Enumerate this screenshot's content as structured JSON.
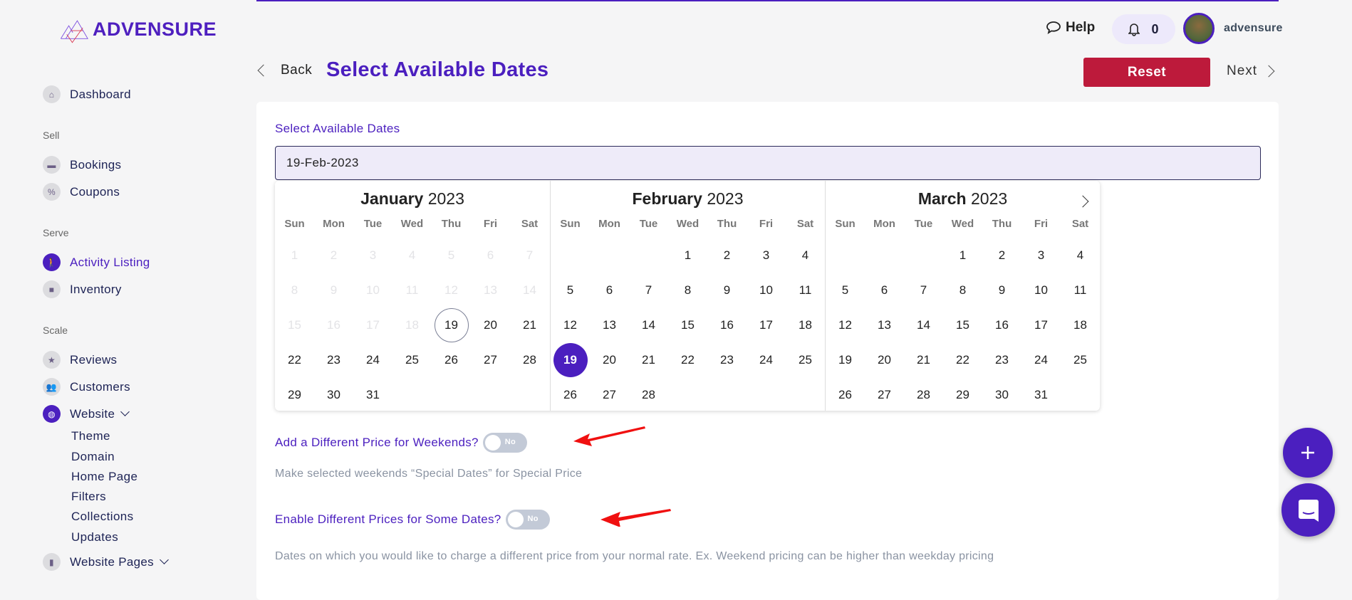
{
  "brand": {
    "name": "ADVENSURE",
    "colors": {
      "primary": "#4b1fbf",
      "danger": "#bd1a3b"
    }
  },
  "sidebar": {
    "items": [
      {
        "label": "Dashboard",
        "icon": "home-icon"
      },
      {
        "section": "Sell"
      },
      {
        "label": "Bookings",
        "icon": "card-icon"
      },
      {
        "label": "Coupons",
        "icon": "percent-icon"
      },
      {
        "section": "Serve"
      },
      {
        "label": "Activity Listing",
        "icon": "hiker-icon",
        "active": true
      },
      {
        "label": "Inventory",
        "icon": "box-icon"
      },
      {
        "section": "Scale"
      },
      {
        "label": "Reviews",
        "icon": "star-icon"
      },
      {
        "label": "Customers",
        "icon": "people-icon"
      },
      {
        "label": "Website",
        "icon": "globe-icon",
        "expanded": true
      },
      {
        "label": "Website Pages",
        "icon": "page-icon"
      }
    ],
    "website_subitems": [
      "Theme",
      "Domain",
      "Home Page",
      "Filters",
      "Collections",
      "Updates"
    ]
  },
  "header": {
    "help": "Help",
    "notifications": "0",
    "username": "advensure"
  },
  "page": {
    "back": "Back",
    "title": "Select Available Dates",
    "reset": "Reset",
    "next": "Next"
  },
  "form": {
    "dates_label": "Select Available Dates",
    "dates_value": "19-Feb-2023",
    "weekend_label": "Add a Different Price for Weekends?",
    "weekend_toggle": "No",
    "weekend_desc": "Make selected weekends “Special Dates” for Special Price",
    "special_label": "Enable Different Prices for Some Dates?",
    "special_toggle": "No",
    "special_desc": "Dates on which you would like to charge a different price from your normal rate. Ex. Weekend pricing can be higher than weekday pricing"
  },
  "calendar": {
    "weekdays": [
      "Sun",
      "Mon",
      "Tue",
      "Wed",
      "Thu",
      "Fri",
      "Sat"
    ],
    "months": [
      {
        "name": "January",
        "year": "2023",
        "first_weekday": 0,
        "days": 31,
        "disabled_through": 18,
        "today": 19
      },
      {
        "name": "February",
        "year": "2023",
        "first_weekday": 3,
        "days": 28,
        "selected": 19
      },
      {
        "name": "March",
        "year": "2023",
        "first_weekday": 3,
        "days": 31
      }
    ]
  }
}
